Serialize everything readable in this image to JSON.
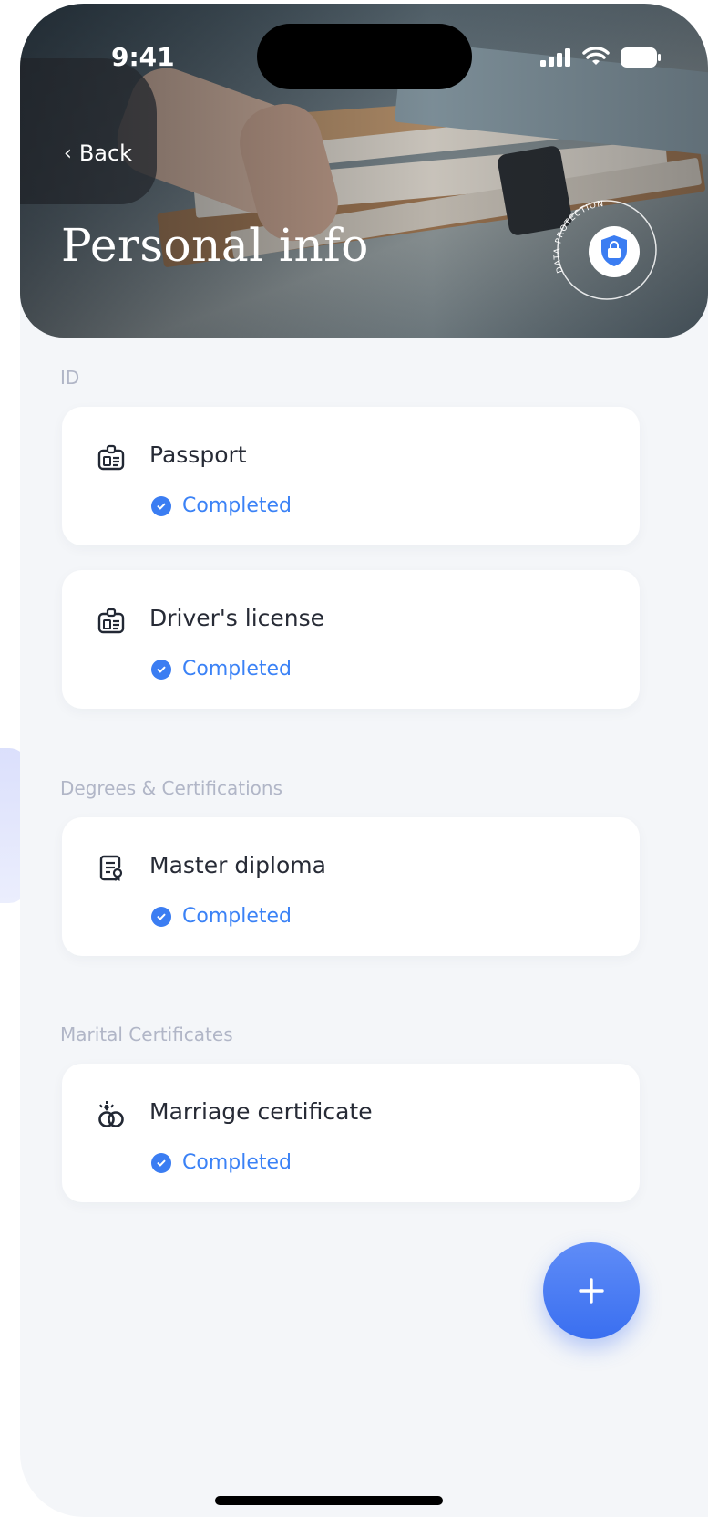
{
  "status_bar": {
    "time": "9:41"
  },
  "header": {
    "back_label": "Back",
    "title": "Personal info",
    "badge_text": "DATA PROTECTION"
  },
  "sections": [
    {
      "label": "ID",
      "items": [
        {
          "name": "Passport",
          "status": "Completed",
          "icon": "id-card-icon"
        },
        {
          "name": "Driver's license",
          "status": "Completed",
          "icon": "id-card-icon"
        }
      ]
    },
    {
      "label": "Degrees & Certifications",
      "items": [
        {
          "name": "Master diploma",
          "status": "Completed",
          "icon": "certificate-icon"
        }
      ]
    },
    {
      "label": "Marital Certificates",
      "items": [
        {
          "name": "Marriage certificate",
          "status": "Completed",
          "icon": "rings-icon"
        }
      ]
    }
  ],
  "fab": {
    "icon": "plus-icon"
  },
  "colors": {
    "accent": "#3b7df2",
    "background": "#f4f6f9",
    "card": "#ffffff"
  }
}
